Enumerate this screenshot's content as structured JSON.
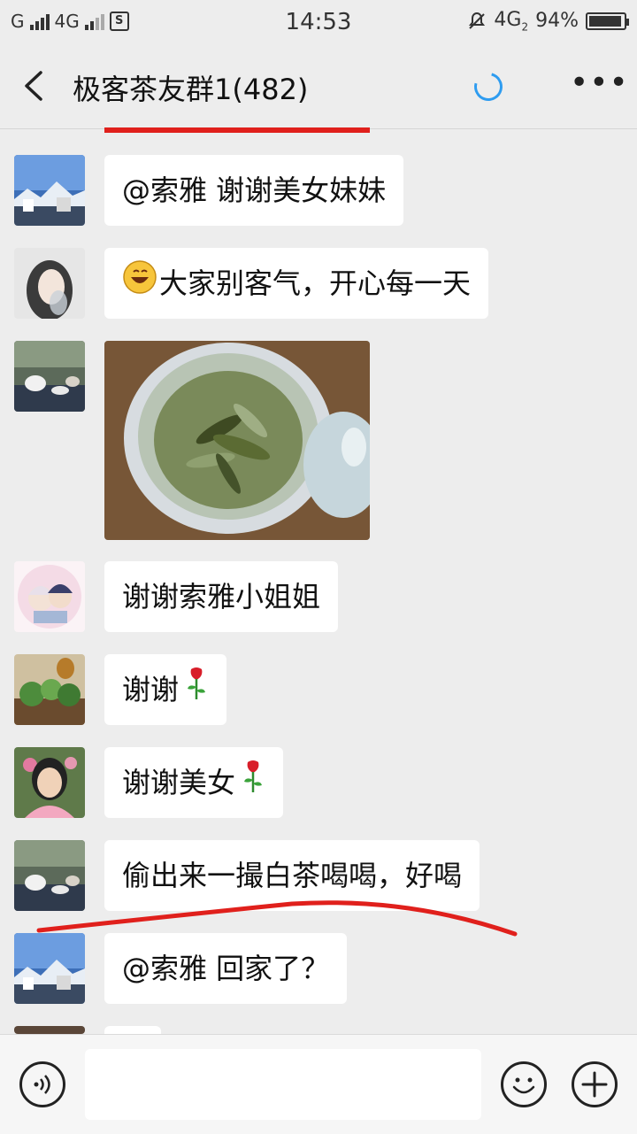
{
  "status": {
    "carrier1": "G",
    "network1": "4G",
    "time": "14:53",
    "network2": "4G",
    "network2_sub": "2",
    "battery": "94%",
    "battery_level": 0.94
  },
  "header": {
    "title": "极客茶友群1(482)",
    "back_icon": "chevron-left-icon",
    "sync_icon": "refresh-icon",
    "more_icon": "more-icon"
  },
  "messages": [
    {
      "text": "@索雅  谢谢美女妹妹",
      "avatar": "landscape-avatar"
    },
    {
      "text": "大家别客气，开心每一天",
      "emoji": "grinning-face-emoji",
      "avatar": "girl-avatar"
    },
    {
      "type": "image",
      "image": "tea-cup-photo",
      "avatar": "tea-avatar"
    },
    {
      "text": "谢谢索雅小姐姐",
      "avatar": "anime-avatar"
    },
    {
      "text": "谢谢",
      "emoji": "rose-emoji",
      "avatar": "plant-avatar"
    },
    {
      "text": "谢谢美女",
      "emoji": "rose-emoji",
      "avatar": "woman-avatar"
    },
    {
      "text": "偷出来一撮白茶喝喝，好喝",
      "avatar": "tea-avatar"
    },
    {
      "text": "@索雅  回家了？",
      "avatar": "landscape-avatar"
    }
  ],
  "input": {
    "value": "",
    "voice_icon": "voice-icon",
    "emoji_icon": "emoji-icon",
    "plus_icon": "plus-icon"
  },
  "colors": {
    "background": "#ededed",
    "bubble": "#ffffff",
    "annotation_red": "#e0201c",
    "accent_blue": "#2e9cf0"
  }
}
